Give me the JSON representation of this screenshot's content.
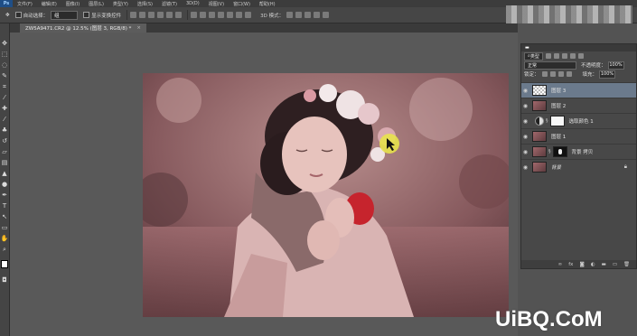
{
  "menubar": {
    "logo": "Ps",
    "items": [
      "文件(F)",
      "编辑(E)",
      "图像(I)",
      "图层(L)",
      "类型(Y)",
      "选择(S)",
      "滤镜(T)",
      "3D(D)",
      "视图(V)",
      "窗口(W)",
      "帮助(H)"
    ]
  },
  "options": {
    "auto_select_label": "自动选择：",
    "auto_select_value": "组",
    "transform_label": "显示变换控件",
    "mode_3d": "3D 模式："
  },
  "tab": {
    "title": "ZW5A9471.CR2 @ 12.5% (图层 3, RGB/8) *",
    "close": "×"
  },
  "layers_panel": {
    "filter_value": "类型",
    "blend_mode": "正常",
    "opacity_label": "不透明度：",
    "opacity_value": "100%",
    "lock_label": "锁定：",
    "fill_label": "填充：",
    "fill_value": "100%",
    "layers": [
      {
        "name": "图层 3",
        "selected": true,
        "thumb": "checker"
      },
      {
        "name": "图层 2",
        "selected": false,
        "thumb": "photo"
      },
      {
        "name": "选取颜色 1",
        "selected": false,
        "thumb": "white",
        "adjustment": true
      },
      {
        "name": "图层 1",
        "selected": false,
        "thumb": "photo"
      },
      {
        "name": "背景 拷贝",
        "selected": false,
        "thumb": "photo",
        "mask": true
      },
      {
        "name": "背景",
        "selected": false,
        "thumb": "photo",
        "locked": true
      }
    ],
    "footer_icons": [
      "∞",
      "fx",
      "◙",
      "◐",
      "▬",
      "▭",
      "🗑"
    ]
  },
  "watermark": "UiBQ.CoM",
  "colors": {
    "selected_layer": "#6b7a8c",
    "bg": "#535353"
  }
}
